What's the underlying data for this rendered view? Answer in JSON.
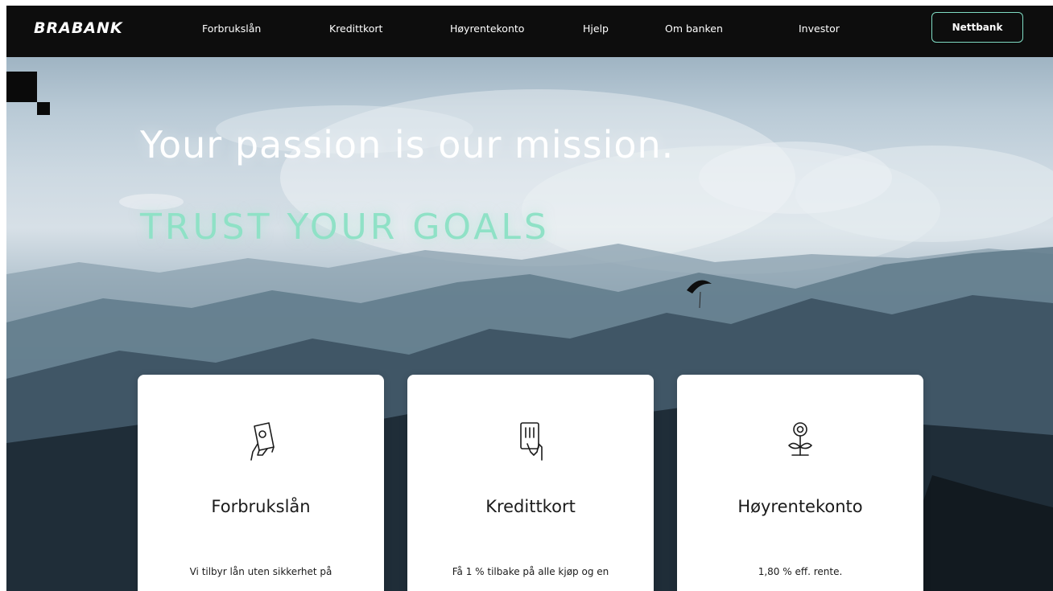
{
  "brand": {
    "logo": "BRABANK"
  },
  "nav": {
    "links": [
      "Forbrukslån",
      "Kredittkort",
      "Høyrentekonto",
      "Hjelp",
      "Om banken",
      "Investor"
    ],
    "cta": "Nettbank"
  },
  "hero": {
    "title": "Your passion is our mission.",
    "subtitle": "TRUST YOUR GOALS"
  },
  "cards": [
    {
      "title": "Forbrukslån",
      "text": "Vi tilbyr lån uten sikkerhet på"
    },
    {
      "title": "Kredittkort",
      "text": "Få 1 % tilbake på alle kjøp og en"
    },
    {
      "title": "Høyrentekonto",
      "text": "1,80 % eff. rente."
    }
  ],
  "icons": {
    "card_0": "hand-holding-card-icon",
    "card_1": "hand-holding-credit-card-icon",
    "card_2": "growing-flower-icon"
  },
  "colors": {
    "nav_bg": "#0d0d0d",
    "accent": "#8fe1c6",
    "cta_border": "#7fdcc3",
    "card_bg": "#ffffff"
  }
}
